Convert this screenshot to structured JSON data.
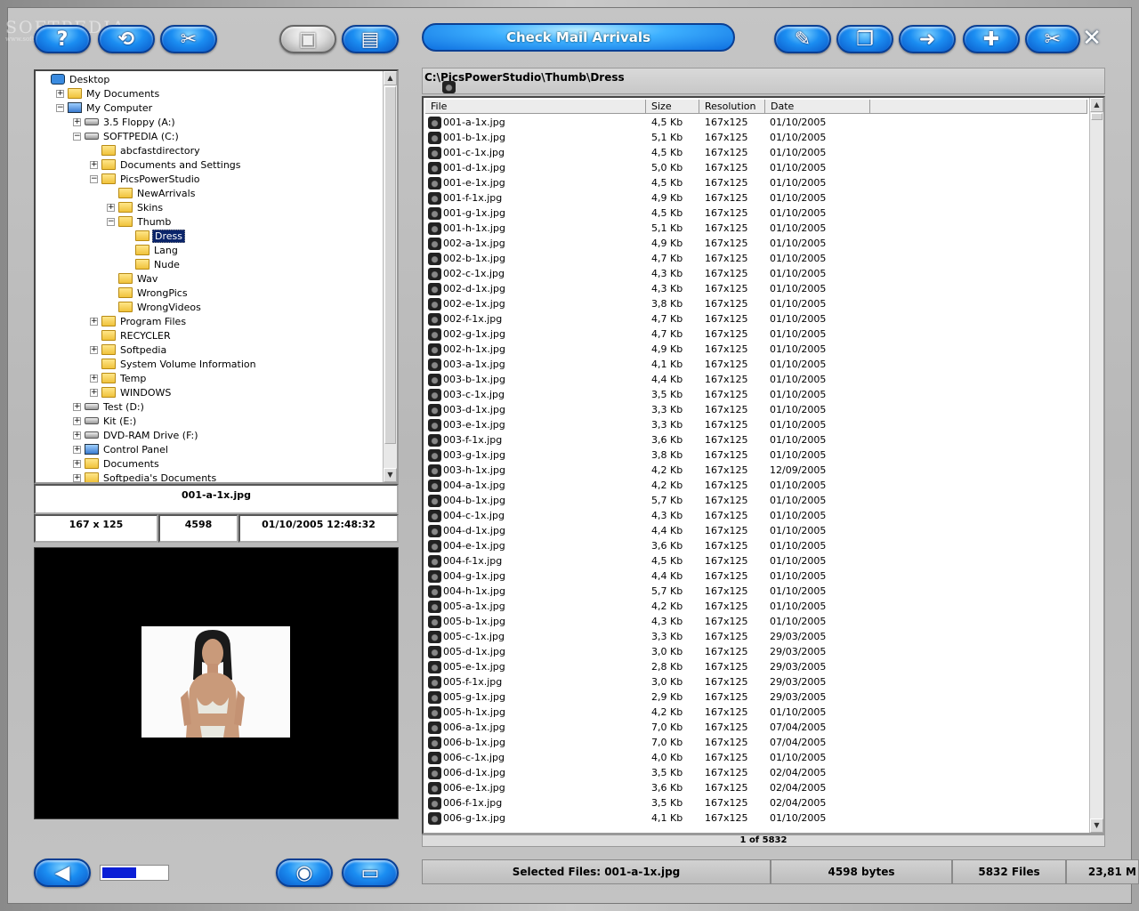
{
  "watermark": {
    "brand": "SOFTPEDIA",
    "url": "www.softpedia.com"
  },
  "toolbar": {
    "left_buttons": [
      {
        "name": "help-button",
        "icon": "question-mark-icon",
        "glyph": "?"
      },
      {
        "name": "refresh-button",
        "icon": "refresh-icon",
        "glyph": "⟲"
      },
      {
        "name": "tools-button",
        "icon": "tools-icon",
        "glyph": "✂"
      },
      {
        "name": "camera-button",
        "icon": "camera-icon",
        "glyph": "▣"
      },
      {
        "name": "video-button",
        "icon": "video-camera-icon",
        "glyph": "▤"
      }
    ],
    "mail_label": "Check Mail Arrivals",
    "right_buttons": [
      {
        "name": "edit-button",
        "icon": "pencil-icon",
        "glyph": "✎"
      },
      {
        "name": "restore-button",
        "icon": "restore-window-icon",
        "glyph": "❐"
      },
      {
        "name": "forward-button",
        "icon": "arrow-right-icon",
        "glyph": "➜"
      },
      {
        "name": "first-aid-button",
        "icon": "medical-kit-icon",
        "glyph": "✚"
      },
      {
        "name": "cut-button",
        "icon": "scissors-icon",
        "glyph": "✂"
      }
    ],
    "close_glyph": "✕"
  },
  "tree": {
    "items": [
      {
        "label": "Desktop",
        "indent": 0,
        "icon": "desktop",
        "exp": ""
      },
      {
        "label": "My Documents",
        "indent": 1,
        "icon": "folder",
        "exp": "+"
      },
      {
        "label": "My Computer",
        "indent": 1,
        "icon": "pc",
        "exp": "−"
      },
      {
        "label": "3.5 Floppy (A:)",
        "indent": 2,
        "icon": "drive",
        "exp": "+"
      },
      {
        "label": "SOFTPEDIA (C:)",
        "indent": 2,
        "icon": "drive",
        "exp": "−"
      },
      {
        "label": "abcfastdirectory",
        "indent": 3,
        "icon": "folder",
        "exp": ""
      },
      {
        "label": "Documents and Settings",
        "indent": 3,
        "icon": "folder",
        "exp": "+"
      },
      {
        "label": "PicsPowerStudio",
        "indent": 3,
        "icon": "folder",
        "exp": "−"
      },
      {
        "label": "NewArrivals",
        "indent": 4,
        "icon": "folder",
        "exp": ""
      },
      {
        "label": "Skins",
        "indent": 4,
        "icon": "folder",
        "exp": "+"
      },
      {
        "label": "Thumb",
        "indent": 4,
        "icon": "folder",
        "exp": "−"
      },
      {
        "label": "Dress",
        "indent": 5,
        "icon": "folder",
        "exp": "",
        "selected": true
      },
      {
        "label": "Lang",
        "indent": 5,
        "icon": "folder",
        "exp": ""
      },
      {
        "label": "Nude",
        "indent": 5,
        "icon": "folder",
        "exp": ""
      },
      {
        "label": "Wav",
        "indent": 4,
        "icon": "folder",
        "exp": ""
      },
      {
        "label": "WrongPics",
        "indent": 4,
        "icon": "folder",
        "exp": ""
      },
      {
        "label": "WrongVideos",
        "indent": 4,
        "icon": "folder",
        "exp": ""
      },
      {
        "label": "Program Files",
        "indent": 3,
        "icon": "folder",
        "exp": "+"
      },
      {
        "label": "RECYCLER",
        "indent": 3,
        "icon": "folder",
        "exp": ""
      },
      {
        "label": "Softpedia",
        "indent": 3,
        "icon": "folder",
        "exp": "+"
      },
      {
        "label": "System Volume Information",
        "indent": 3,
        "icon": "folder",
        "exp": ""
      },
      {
        "label": "Temp",
        "indent": 3,
        "icon": "folder",
        "exp": "+"
      },
      {
        "label": "WINDOWS",
        "indent": 3,
        "icon": "folder",
        "exp": "+"
      },
      {
        "label": "Test (D:)",
        "indent": 2,
        "icon": "drive",
        "exp": "+"
      },
      {
        "label": "Kit (E:)",
        "indent": 2,
        "icon": "drive",
        "exp": "+"
      },
      {
        "label": "DVD-RAM Drive (F:)",
        "indent": 2,
        "icon": "drive",
        "exp": "+"
      },
      {
        "label": "Control Panel",
        "indent": 2,
        "icon": "pc",
        "exp": "+"
      },
      {
        "label": "Documents",
        "indent": 2,
        "icon": "folder",
        "exp": "+"
      },
      {
        "label": "Softpedia's Documents",
        "indent": 2,
        "icon": "folder",
        "exp": "+"
      }
    ]
  },
  "info": {
    "filename": "001-a-1x.jpg",
    "dimensions": "167 x 125",
    "size": "4598",
    "datetime": "01/10/2005 12:48:32"
  },
  "path": "C:\\PicsPowerStudio\\Thumb\\Dress",
  "list": {
    "columns": [
      "File",
      "Size",
      "Resolution",
      "Date"
    ],
    "rows": [
      [
        "001-a-1x.jpg",
        "4,5 Kb",
        "167x125",
        "01/10/2005"
      ],
      [
        "001-b-1x.jpg",
        "5,1 Kb",
        "167x125",
        "01/10/2005"
      ],
      [
        "001-c-1x.jpg",
        "4,5 Kb",
        "167x125",
        "01/10/2005"
      ],
      [
        "001-d-1x.jpg",
        "5,0 Kb",
        "167x125",
        "01/10/2005"
      ],
      [
        "001-e-1x.jpg",
        "4,5 Kb",
        "167x125",
        "01/10/2005"
      ],
      [
        "001-f-1x.jpg",
        "4,9 Kb",
        "167x125",
        "01/10/2005"
      ],
      [
        "001-g-1x.jpg",
        "4,5 Kb",
        "167x125",
        "01/10/2005"
      ],
      [
        "001-h-1x.jpg",
        "5,1 Kb",
        "167x125",
        "01/10/2005"
      ],
      [
        "002-a-1x.jpg",
        "4,9 Kb",
        "167x125",
        "01/10/2005"
      ],
      [
        "002-b-1x.jpg",
        "4,7 Kb",
        "167x125",
        "01/10/2005"
      ],
      [
        "002-c-1x.jpg",
        "4,3 Kb",
        "167x125",
        "01/10/2005"
      ],
      [
        "002-d-1x.jpg",
        "4,3 Kb",
        "167x125",
        "01/10/2005"
      ],
      [
        "002-e-1x.jpg",
        "3,8 Kb",
        "167x125",
        "01/10/2005"
      ],
      [
        "002-f-1x.jpg",
        "4,7 Kb",
        "167x125",
        "01/10/2005"
      ],
      [
        "002-g-1x.jpg",
        "4,7 Kb",
        "167x125",
        "01/10/2005"
      ],
      [
        "002-h-1x.jpg",
        "4,9 Kb",
        "167x125",
        "01/10/2005"
      ],
      [
        "003-a-1x.jpg",
        "4,1 Kb",
        "167x125",
        "01/10/2005"
      ],
      [
        "003-b-1x.jpg",
        "4,4 Kb",
        "167x125",
        "01/10/2005"
      ],
      [
        "003-c-1x.jpg",
        "3,5 Kb",
        "167x125",
        "01/10/2005"
      ],
      [
        "003-d-1x.jpg",
        "3,3 Kb",
        "167x125",
        "01/10/2005"
      ],
      [
        "003-e-1x.jpg",
        "3,3 Kb",
        "167x125",
        "01/10/2005"
      ],
      [
        "003-f-1x.jpg",
        "3,6 Kb",
        "167x125",
        "01/10/2005"
      ],
      [
        "003-g-1x.jpg",
        "3,8 Kb",
        "167x125",
        "01/10/2005"
      ],
      [
        "003-h-1x.jpg",
        "4,2 Kb",
        "167x125",
        "12/09/2005"
      ],
      [
        "004-a-1x.jpg",
        "4,2 Kb",
        "167x125",
        "01/10/2005"
      ],
      [
        "004-b-1x.jpg",
        "5,7 Kb",
        "167x125",
        "01/10/2005"
      ],
      [
        "004-c-1x.jpg",
        "4,3 Kb",
        "167x125",
        "01/10/2005"
      ],
      [
        "004-d-1x.jpg",
        "4,4 Kb",
        "167x125",
        "01/10/2005"
      ],
      [
        "004-e-1x.jpg",
        "3,6 Kb",
        "167x125",
        "01/10/2005"
      ],
      [
        "004-f-1x.jpg",
        "4,5 Kb",
        "167x125",
        "01/10/2005"
      ],
      [
        "004-g-1x.jpg",
        "4,4 Kb",
        "167x125",
        "01/10/2005"
      ],
      [
        "004-h-1x.jpg",
        "5,7 Kb",
        "167x125",
        "01/10/2005"
      ],
      [
        "005-a-1x.jpg",
        "4,2 Kb",
        "167x125",
        "01/10/2005"
      ],
      [
        "005-b-1x.jpg",
        "4,3 Kb",
        "167x125",
        "01/10/2005"
      ],
      [
        "005-c-1x.jpg",
        "3,3 Kb",
        "167x125",
        "29/03/2005"
      ],
      [
        "005-d-1x.jpg",
        "3,0 Kb",
        "167x125",
        "29/03/2005"
      ],
      [
        "005-e-1x.jpg",
        "2,8 Kb",
        "167x125",
        "29/03/2005"
      ],
      [
        "005-f-1x.jpg",
        "3,0 Kb",
        "167x125",
        "29/03/2005"
      ],
      [
        "005-g-1x.jpg",
        "2,9 Kb",
        "167x125",
        "29/03/2005"
      ],
      [
        "005-h-1x.jpg",
        "4,2 Kb",
        "167x125",
        "01/10/2005"
      ],
      [
        "006-a-1x.jpg",
        "7,0 Kb",
        "167x125",
        "07/04/2005"
      ],
      [
        "006-b-1x.jpg",
        "7,0 Kb",
        "167x125",
        "07/04/2005"
      ],
      [
        "006-c-1x.jpg",
        "4,0 Kb",
        "167x125",
        "01/10/2005"
      ],
      [
        "006-d-1x.jpg",
        "3,5 Kb",
        "167x125",
        "02/04/2005"
      ],
      [
        "006-e-1x.jpg",
        "3,6 Kb",
        "167x125",
        "02/04/2005"
      ],
      [
        "006-f-1x.jpg",
        "3,5 Kb",
        "167x125",
        "02/04/2005"
      ],
      [
        "006-g-1x.jpg",
        "4,1 Kb",
        "167x125",
        "01/10/2005"
      ]
    ]
  },
  "pager": "1 of 5832",
  "status": {
    "selected": "Selected Files: 001-a-1x.jpg",
    "bytes": "4598 bytes",
    "files": "5832 Files",
    "total": "23,81 M"
  },
  "volume_level": 0.52,
  "bottom_buttons": [
    {
      "name": "sound-button",
      "icon": "speaker-icon",
      "glyph": "◀"
    },
    {
      "name": "view-button",
      "icon": "eye-icon",
      "glyph": "◉"
    },
    {
      "name": "monitor-button",
      "icon": "monitor-icon",
      "glyph": "▭"
    }
  ]
}
